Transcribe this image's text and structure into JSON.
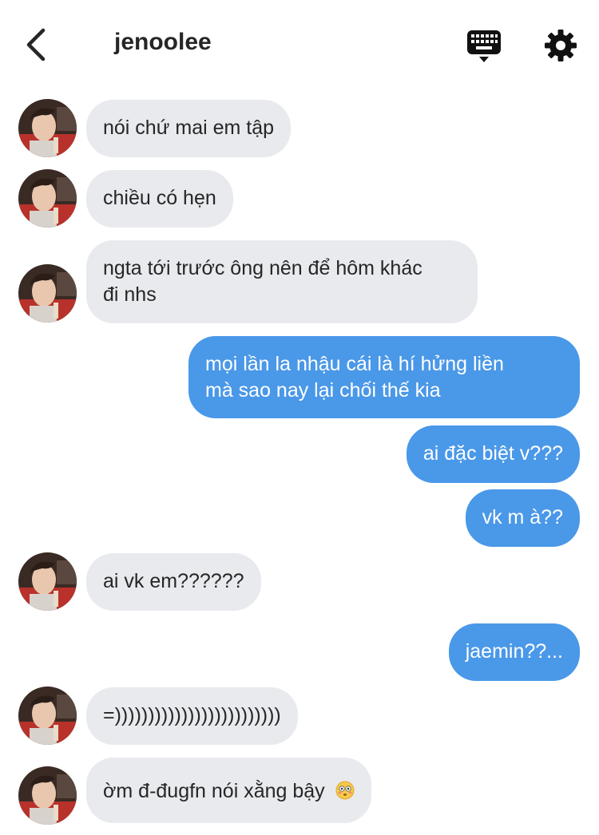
{
  "header": {
    "title": "jenoolee",
    "back_icon": "chevron-left-icon",
    "keyboard_icon": "keyboard-icon",
    "settings_icon": "gear-icon"
  },
  "colors": {
    "incoming_bubble": "#e8eaee",
    "outgoing_bubble": "#4a98e8",
    "text": "#262626"
  },
  "messages": [
    {
      "from": "them",
      "text": "nói chứ mai em tập"
    },
    {
      "from": "them",
      "text": "chiều có hẹn"
    },
    {
      "from": "them",
      "line1": "ngta tới trước ông nên để hôm khác",
      "line2": "đi nhs"
    },
    {
      "from": "me",
      "line1": "mọi lần la nhậu cái là hí hửng liền",
      "line2": "mà sao nay lại chối thế kia"
    },
    {
      "from": "me",
      "text": "ai đặc biệt v???"
    },
    {
      "from": "me",
      "text": "vk m à??"
    },
    {
      "from": "them",
      "text": "ai vk em??????"
    },
    {
      "from": "me",
      "text": "jaemin??..."
    },
    {
      "from": "them",
      "text": "=)))))))))))))))))))))))))"
    },
    {
      "from": "them",
      "text": "ờm đ-đugfn nói xằng bậy",
      "emoji": "flushed-face-emoji"
    }
  ]
}
